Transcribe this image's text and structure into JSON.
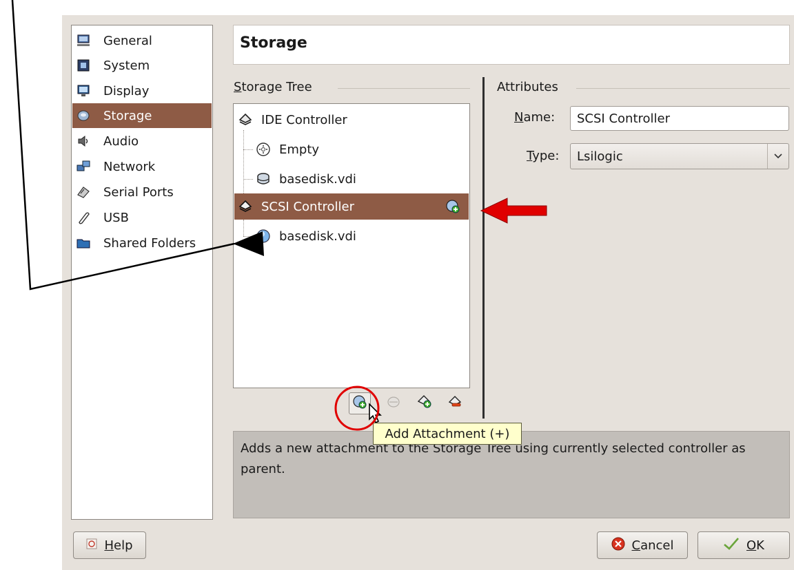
{
  "window_title_fragment": "",
  "nav": {
    "items": [
      {
        "label": "General",
        "icon": "monitor-icon"
      },
      {
        "label": "System",
        "icon": "chip-icon"
      },
      {
        "label": "Display",
        "icon": "display-icon"
      },
      {
        "label": "Storage",
        "icon": "disk-icon",
        "selected": true
      },
      {
        "label": "Audio",
        "icon": "speaker-icon"
      },
      {
        "label": "Network",
        "icon": "network-icon"
      },
      {
        "label": "Serial Ports",
        "icon": "serial-port-icon"
      },
      {
        "label": "USB",
        "icon": "usb-icon"
      },
      {
        "label": "Shared Folders",
        "icon": "folder-icon"
      }
    ]
  },
  "page_title": "Storage",
  "storage_tree": {
    "label_first": "S",
    "label_rest": "torage Tree",
    "items": [
      {
        "label": "IDE Controller",
        "kind": "controller"
      },
      {
        "label": "Empty",
        "kind": "cd"
      },
      {
        "label": "basedisk.vdi",
        "kind": "hdd"
      },
      {
        "label": "SCSI Controller",
        "kind": "controller",
        "selected": true
      },
      {
        "label": "basedisk.vdi",
        "kind": "disk"
      }
    ]
  },
  "attributes": {
    "label": "Attributes",
    "name_label_first": "N",
    "name_label_rest": "ame:",
    "name_value": "SCSI Controller",
    "type_label_first": "T",
    "type_label_rest": "ype:",
    "type_value": "Lsilogic"
  },
  "toolbar": {
    "tooltip": "Add Attachment (+)"
  },
  "description": "Adds a new attachment to the Storage Tree using currently selected controller as parent.",
  "buttons": {
    "help_first": "H",
    "help_rest": "elp",
    "cancel_first": "C",
    "cancel_rest": "ancel",
    "ok_first": "O",
    "ok_rest": "K"
  },
  "colors": {
    "selection": "#8e5b45",
    "dialog_bg": "#e6e1db",
    "annotation_red": "#e00000",
    "tooltip_bg": "#ffffcc"
  }
}
